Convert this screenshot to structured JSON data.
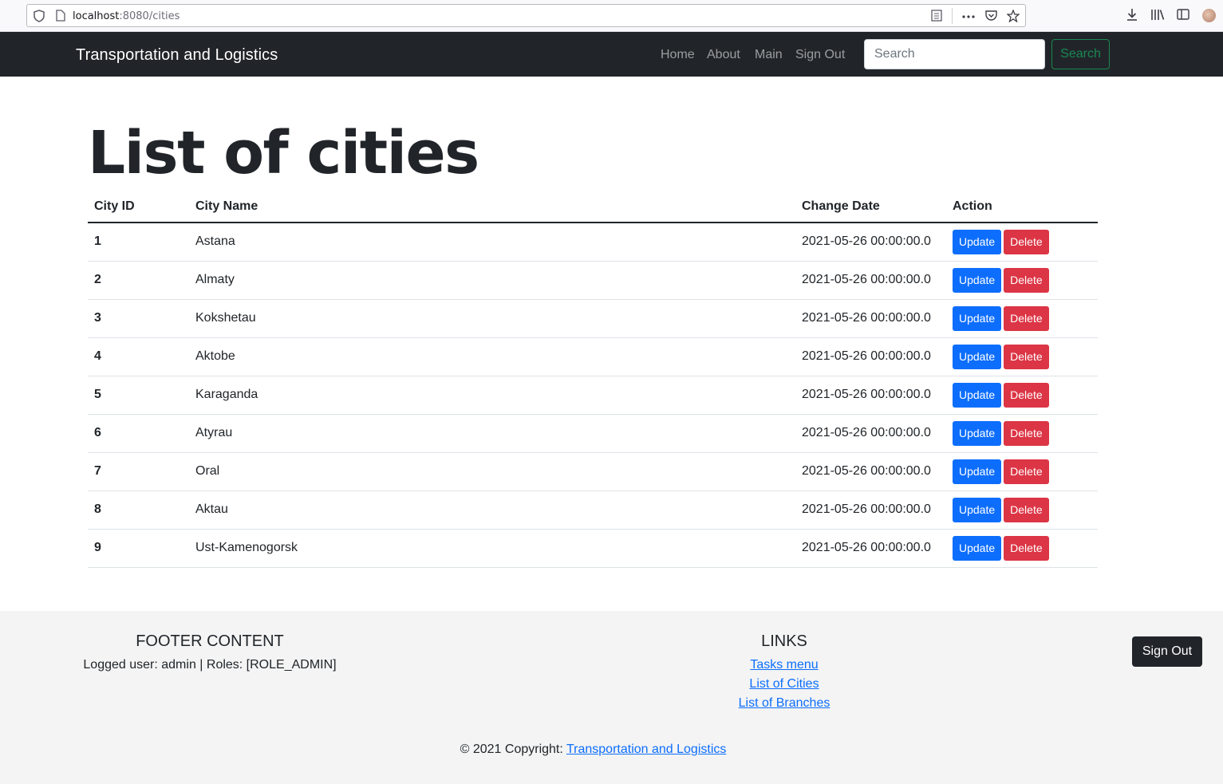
{
  "browser": {
    "url_host": "localhost",
    "url_rest": ":8080/cities"
  },
  "navbar": {
    "brand": "Transportation and Logistics",
    "links": [
      "Home",
      "About",
      "Main",
      "Sign Out"
    ],
    "search_placeholder": "Search",
    "search_button": "Search",
    "search_button_color": "#198754"
  },
  "main": {
    "title": "List of cities",
    "columns": [
      "City ID",
      "City Name",
      "Change Date",
      "Action"
    ],
    "update_label": "Update",
    "delete_label": "Delete",
    "update_color": "#0d6efd",
    "delete_color": "#dc3545",
    "rows": [
      {
        "id": "1",
        "name": "Astana",
        "date": "2021-05-26 00:00:00.0"
      },
      {
        "id": "2",
        "name": "Almaty",
        "date": "2021-05-26 00:00:00.0"
      },
      {
        "id": "3",
        "name": "Kokshetau",
        "date": "2021-05-26 00:00:00.0"
      },
      {
        "id": "4",
        "name": "Aktobe",
        "date": "2021-05-26 00:00:00.0"
      },
      {
        "id": "5",
        "name": "Karaganda",
        "date": "2021-05-26 00:00:00.0"
      },
      {
        "id": "6",
        "name": "Atyrau",
        "date": "2021-05-26 00:00:00.0"
      },
      {
        "id": "7",
        "name": "Oral",
        "date": "2021-05-26 00:00:00.0"
      },
      {
        "id": "8",
        "name": "Aktau",
        "date": "2021-05-26 00:00:00.0"
      },
      {
        "id": "9",
        "name": "Ust-Kamenogorsk",
        "date": "2021-05-26 00:00:00.0"
      }
    ]
  },
  "footer": {
    "content_heading": "FOOTER CONTENT",
    "user_info": "Logged user: admin | Roles: [ROLE_ADMIN]",
    "links_heading": "LINKS",
    "links": [
      "Tasks menu",
      "List of Cities",
      "List of Branches"
    ],
    "signout_button": "Sign Out",
    "copyright_prefix": "© 2021 Copyright: ",
    "copyright_link": "Transportation and Logistics"
  }
}
